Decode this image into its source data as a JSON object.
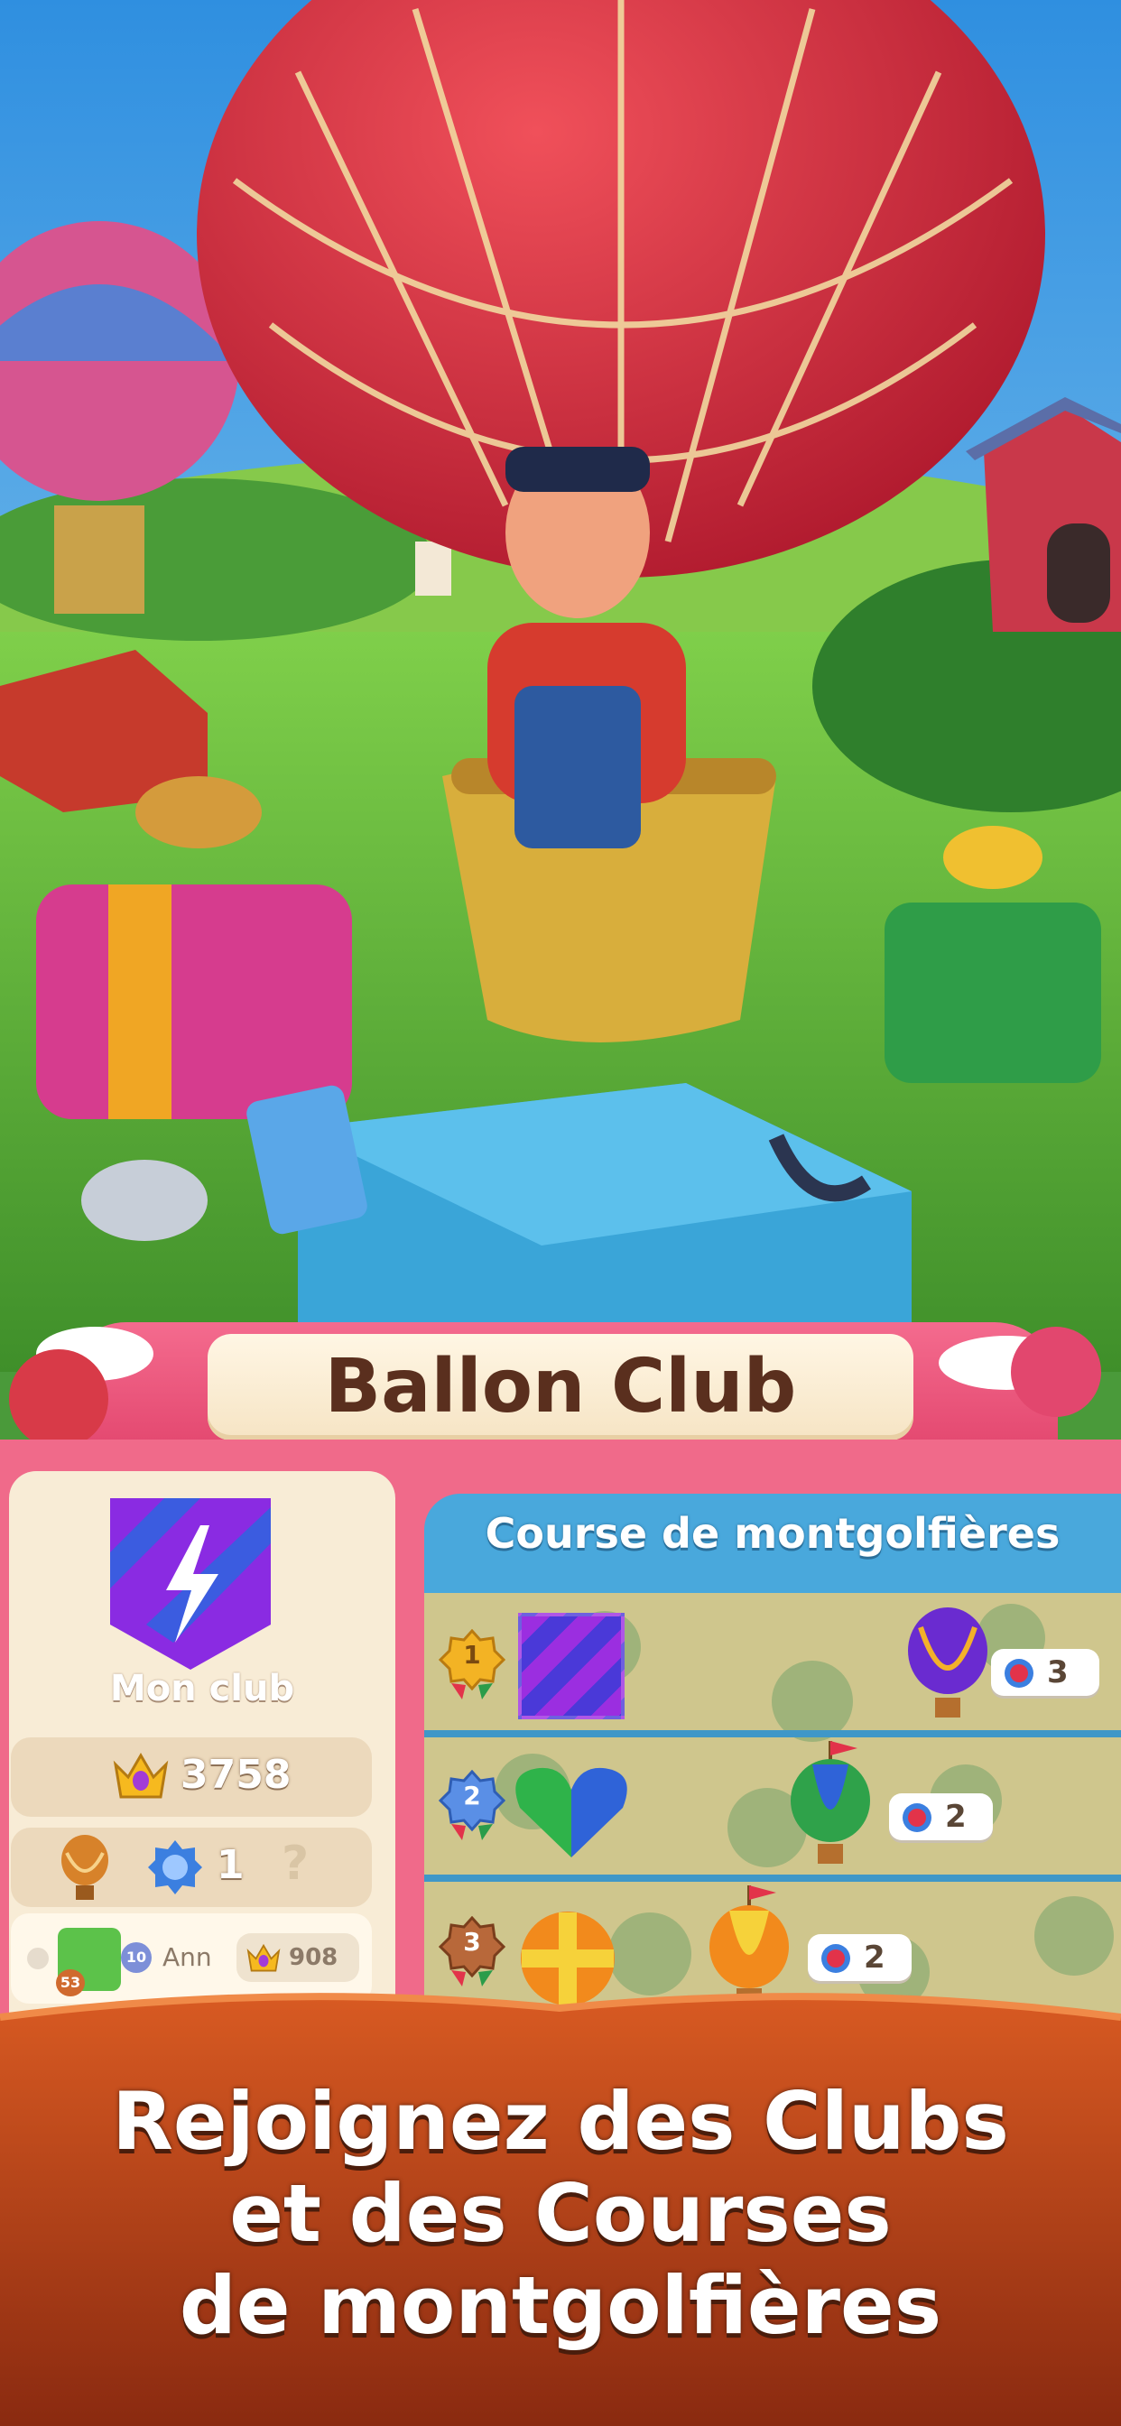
{
  "banner": {
    "title": "Ballon Club"
  },
  "club": {
    "label": "Mon club",
    "score": "3758",
    "medal_count": "1",
    "unknown_slot": "?"
  },
  "member": {
    "level": "53",
    "rank": "10",
    "name": "Ann",
    "score": "908"
  },
  "race": {
    "title": "Course de montgolfières",
    "entries": [
      {
        "place": "1",
        "emblem": "purple-stripes-emblem",
        "balloons": "3"
      },
      {
        "place": "2",
        "emblem": "blue-green-heart-emblem",
        "balloons": "2"
      },
      {
        "place": "3",
        "emblem": "orange-cross-emblem",
        "balloons": "2"
      }
    ]
  },
  "promo": {
    "line1": "Rejoignez des Clubs",
    "line2": "et des Courses",
    "line3": "de montgolfières"
  },
  "colors": {
    "accent": "#e2456d",
    "race_blue": "#49a8dc",
    "wood": "#c14e1e"
  }
}
